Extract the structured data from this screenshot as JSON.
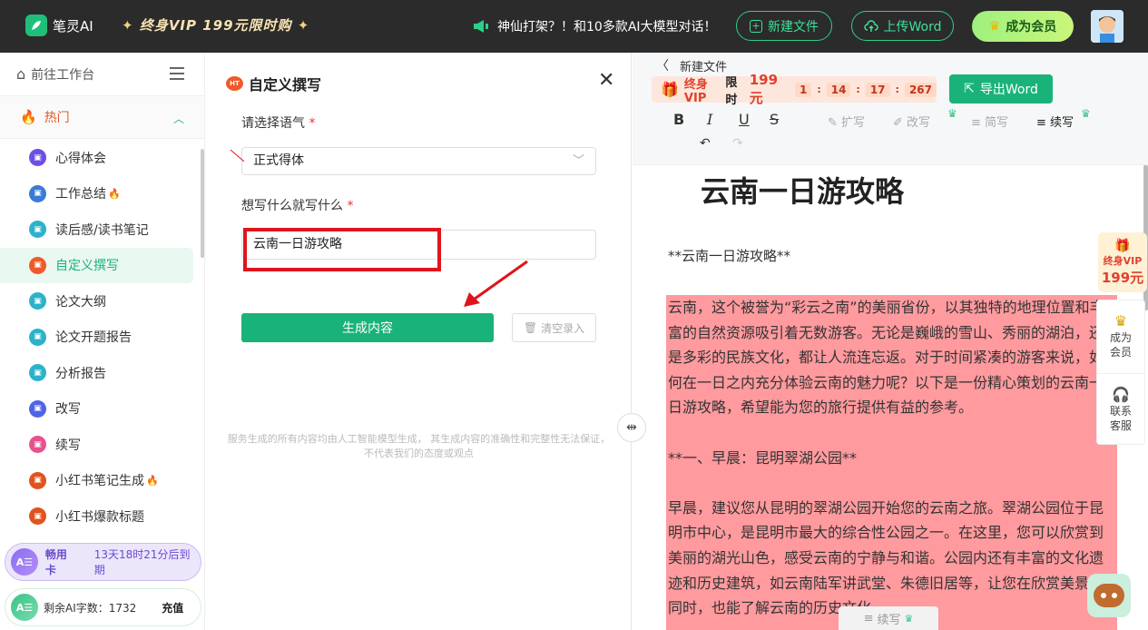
{
  "app": {
    "name": "笔灵AI",
    "vip_promo": "终身VIP 199元限时购",
    "notice": "神仙打架？！和10多款AI大模型对话！",
    "new_file_label": "新建文件",
    "upload_word_label": "上传Word",
    "member_label": "成为会员"
  },
  "sidebar": {
    "workspace_label": "前往工作台",
    "section_label": "热门",
    "items": [
      {
        "label": "心得体会",
        "color": "#6c4ee8",
        "hot": false
      },
      {
        "label": "工作总结",
        "color": "#3a7bd5",
        "hot": true
      },
      {
        "label": "读后感/读书笔记",
        "color": "#2bb3c9",
        "hot": false
      },
      {
        "label": "自定义撰写",
        "color": "#ef5a2a",
        "hot": false,
        "active": true
      },
      {
        "label": "论文大纲",
        "color": "#2bb3c9",
        "hot": false
      },
      {
        "label": "论文开题报告",
        "color": "#2bb3c9",
        "hot": false
      },
      {
        "label": "分析报告",
        "color": "#2bb3c9",
        "hot": false
      },
      {
        "label": "改写",
        "color": "#5063e8",
        "hot": false
      },
      {
        "label": "续写",
        "color": "#e8508e",
        "hot": false
      },
      {
        "label": "小红书笔记生成",
        "color": "#e0531f",
        "hot": true
      },
      {
        "label": "小红书爆款标题",
        "color": "#e0531f",
        "hot": false
      }
    ],
    "pass_label": "畅用卡",
    "pass_expiry": "13天18时21分后到期",
    "words_label": "剩余AI字数：1732",
    "recharge_label": "充值"
  },
  "form": {
    "title": "自定义撰写",
    "tone_label": "请选择语气",
    "tone_value": "正式得体",
    "content_label": "想写什么就写什么",
    "content_value": "云南一日游攻略",
    "generate_label": "生成内容",
    "clear_label": "清空录入",
    "disclaimer": "服务生成的所有内容均由人工智能模型生成， 其生成内容的准确性和完整性无法保证， 不代表我们的态度或观点"
  },
  "editor": {
    "breadcrumb": "新建文件",
    "vip_label": "终身VIP",
    "limited_label": "限时",
    "price": "199元",
    "timer": [
      "1",
      "14",
      "17",
      "267"
    ],
    "export_label": "导出Word",
    "tools": {
      "expand": "扩写",
      "rewrite": "改写",
      "simplify": "简写",
      "continue": "续写"
    },
    "doc_title": "云南一日游攻略",
    "doc_subtitle": "**云南一日游攻略**",
    "paragraphs": [
      "云南，这个被誉为“彩云之南”的美丽省份，以其独特的地理位置和丰富的自然资源吸引着无数游客。无论是巍峨的雪山、秀丽的湖泊，还是多彩的民族文化，都让人流连忘返。对于时间紧凑的游客来说，如何在一日之内充分体验云南的魅力呢？以下是一份精心策划的云南一日游攻略，希望能为您的旅行提供有益的参考。",
      "**一、早晨：昆明翠湖公园**",
      "早晨，建议您从昆明的翠湖公园开始您的云南之旅。翠湖公园位于昆明市中心，是昆明市最大的综合性公园之一。在这里，您可以欣赏到美丽的湖光山色，感受云南的宁静与和谐。公园内还有丰富的文化遗迹和历史建筑，如云南陆军讲武堂、朱德旧居等，让您在欣赏美景的同时，也能了解云南的历史文化。"
    ],
    "float_vip_top": "终身VIP",
    "float_vip_price": "199元",
    "float_member": "成为会员",
    "float_service": "联系客服",
    "continue_label": "续写",
    "highlight_color": "#ff9a9e"
  }
}
